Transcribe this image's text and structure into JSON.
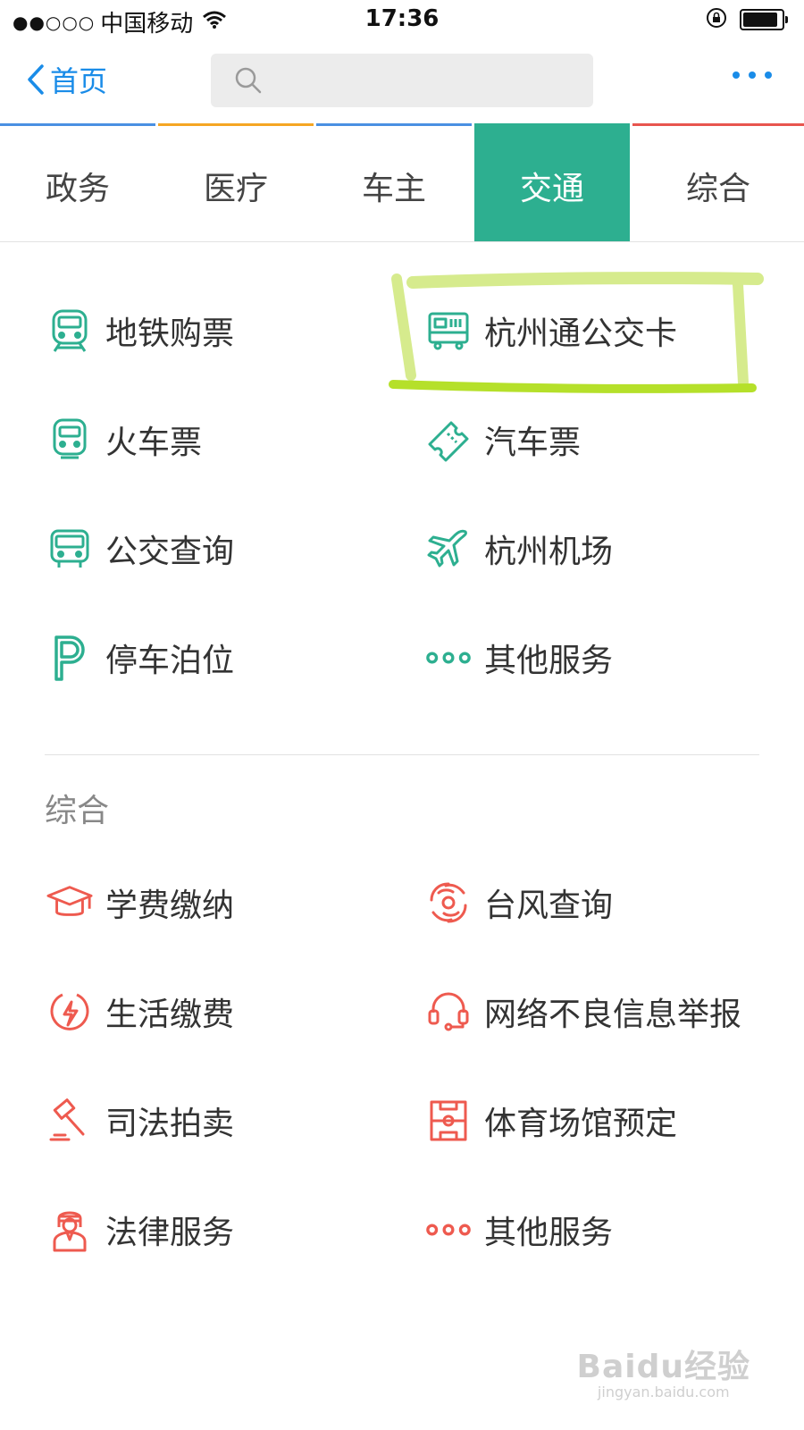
{
  "status_bar": {
    "signal": "●●○○○",
    "carrier": "中国移动",
    "time": "17:36",
    "battery_level": 0.9
  },
  "nav": {
    "back_label": "首页",
    "search_placeholder": ""
  },
  "tabs": [
    {
      "label": "政务",
      "color": "#4a90e2"
    },
    {
      "label": "医疗",
      "color": "#f5a623"
    },
    {
      "label": "车主",
      "color": "#4a90e2"
    },
    {
      "label": "交通",
      "color": "#2daf90",
      "active": true
    },
    {
      "label": "综合",
      "color": "#e8554e"
    }
  ],
  "colors": {
    "accent": "#1a8ce8",
    "teal": "#2daf90",
    "red": "#ee5a4f",
    "highlight": "#b5e02a"
  },
  "transport": {
    "items": [
      {
        "label": "地铁购票",
        "icon": "subway-icon"
      },
      {
        "label": "杭州通公交卡",
        "icon": "bus-card-icon"
      },
      {
        "label": "火车票",
        "icon": "train-icon"
      },
      {
        "label": "汽车票",
        "icon": "ticket-icon"
      },
      {
        "label": "公交查询",
        "icon": "bus-icon"
      },
      {
        "label": "杭州机场",
        "icon": "airplane-icon"
      },
      {
        "label": "停车泊位",
        "icon": "parking-icon"
      },
      {
        "label": "其他服务",
        "icon": "more-dots-icon"
      }
    ]
  },
  "general": {
    "title": "综合",
    "items": [
      {
        "label": "学费缴纳",
        "icon": "graduation-cap-icon"
      },
      {
        "label": "台风查询",
        "icon": "typhoon-icon"
      },
      {
        "label": "生活缴费",
        "icon": "utility-bolt-icon"
      },
      {
        "label": "网络不良信息举报",
        "icon": "headset-icon"
      },
      {
        "label": "司法拍卖",
        "icon": "gavel-icon"
      },
      {
        "label": "体育场馆预定",
        "icon": "stadium-icon"
      },
      {
        "label": "法律服务",
        "icon": "lawyer-icon"
      },
      {
        "label": "其他服务",
        "icon": "more-dots-icon"
      }
    ]
  },
  "watermark": {
    "main": "Baidu经验",
    "sub": "jingyan.baidu.com"
  }
}
